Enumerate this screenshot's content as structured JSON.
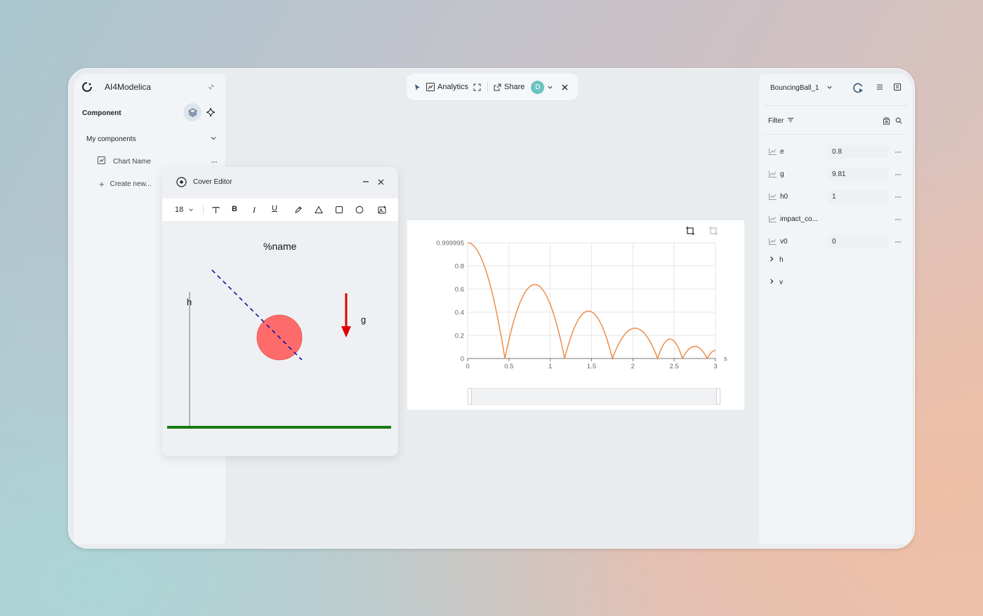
{
  "app": {
    "name": "AI4Modelica"
  },
  "left_panel": {
    "section_title": "Component",
    "group_label": "My components",
    "items": [
      {
        "label": "Chart Name"
      }
    ],
    "create_label": "Create new..."
  },
  "top_toolbar": {
    "analytics_label": "Analytics",
    "share_label": "Share",
    "avatar_initial": "D"
  },
  "cover_editor": {
    "title": "Cover Editor",
    "font_size": "18",
    "canvas": {
      "name_text": "%name",
      "h_label": "h",
      "g_label": "g",
      "ball_color": "#ff6b6b",
      "arrow_color": "#e00000",
      "ground_color": "#147a14",
      "dash_color": "#1010a0"
    }
  },
  "chart_data": {
    "type": "line",
    "title": "",
    "xlabel": "s",
    "ylabel": "",
    "xlim": [
      0,
      3
    ],
    "ylim": [
      0,
      0.999995
    ],
    "x_ticks": [
      "0",
      "0.5",
      "1",
      "1.5",
      "2",
      "2.5",
      "3"
    ],
    "y_ticks": [
      "0",
      "0.2",
      "0.4",
      "0.6",
      "0.8",
      "0.999995"
    ],
    "series_color": "#ee8c4a",
    "series": [
      {
        "name": "h",
        "x": [
          0,
          0.1,
          0.2,
          0.3,
          0.4,
          0.4515,
          0.55,
          0.65,
          0.8128,
          0.95,
          1.05,
          1.1741,
          1.25,
          1.35,
          1.4632,
          1.6,
          1.7523,
          1.85,
          1.98,
          2.1836,
          2.3,
          2.3568,
          2.45,
          2.5416,
          2.6,
          2.6955,
          2.75,
          2.8341,
          2.9,
          2.9449,
          3.0
        ],
        "y": [
          0.999995,
          0.95,
          0.8,
          0.56,
          0.215,
          0,
          0.46,
          0.62,
          0.64,
          0.54,
          0.29,
          0,
          0.3,
          0.38,
          0.41,
          0.32,
          0,
          0.18,
          0.262,
          0.08,
          0,
          0.1,
          0.168,
          0.09,
          0,
          0.09,
          0.105,
          0.04,
          0,
          0.04,
          0.07
        ]
      }
    ]
  },
  "right_panel": {
    "model_name": "BouncingBall_1",
    "filter_label": "Filter",
    "params": [
      {
        "name": "e",
        "value": "0.8"
      },
      {
        "name": "g",
        "value": "9.81"
      },
      {
        "name": "h0",
        "value": "1"
      },
      {
        "name": "impact_co...",
        "value": ""
      },
      {
        "name": "v0",
        "value": "0"
      }
    ],
    "variables": [
      {
        "name": "h"
      },
      {
        "name": "v"
      }
    ]
  }
}
